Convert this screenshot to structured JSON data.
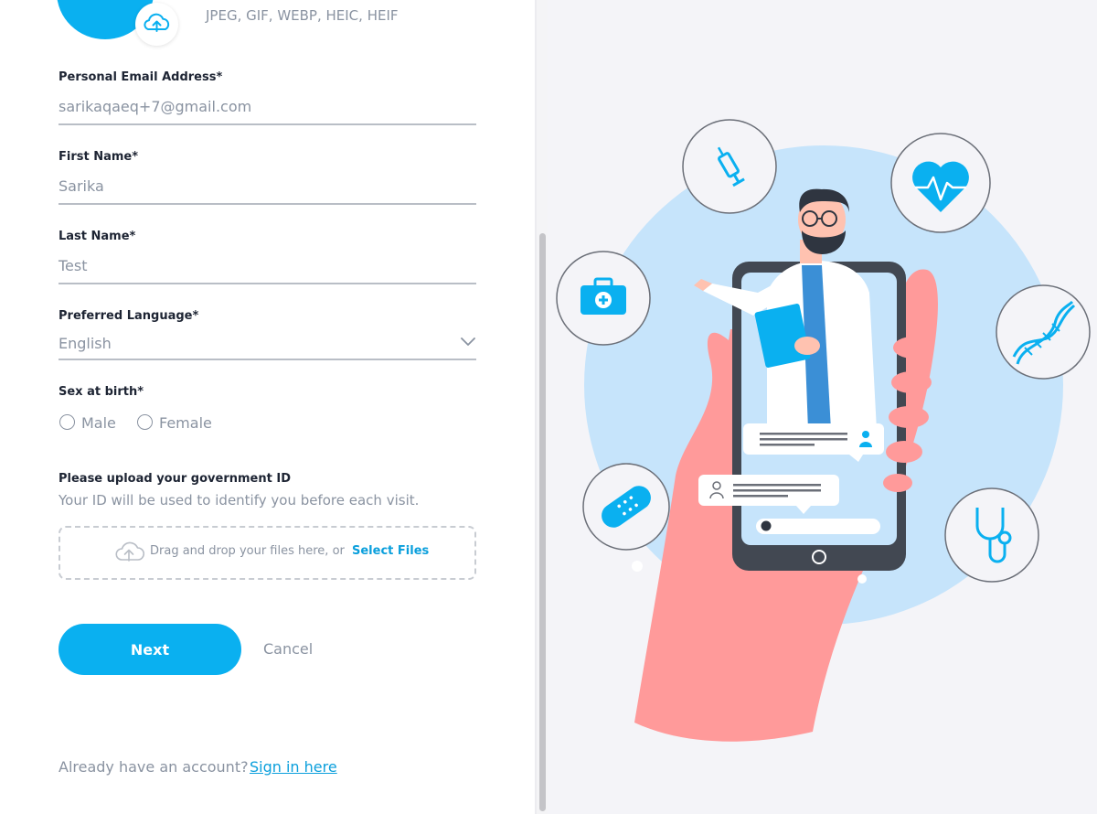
{
  "photo_upload": {
    "formats_text": "JPEG, GIF, WEBP, HEIC, HEIF",
    "upload_icon": "cloud-upload-icon"
  },
  "form": {
    "email": {
      "label": "Personal Email Address*",
      "value": "sarikaqaeq+7@gmail.com"
    },
    "first_name": {
      "label": "First Name*",
      "value": "Sarika"
    },
    "last_name": {
      "label": "Last Name*",
      "value": "Test"
    },
    "language": {
      "label": "Preferred Language*",
      "value": "English",
      "icon": "chevron-down-icon"
    },
    "sex": {
      "label": "Sex at birth*",
      "options": [
        "Male",
        "Female"
      ]
    },
    "government_id": {
      "label": "Please upload your government ID",
      "help": "Your ID will be used to identify you before each visit.",
      "dropzone_text": "Drag and drop your files here, or",
      "dropzone_link": "Select Files",
      "icon": "cloud-upload-icon"
    }
  },
  "actions": {
    "next": "Next",
    "cancel": "Cancel"
  },
  "footer": {
    "text": "Already have an account?",
    "link": "Sign in here"
  },
  "colors": {
    "accent": "#0ab0f0",
    "link": "#0a9fdc",
    "muted_text": "#8a93a1",
    "label_text": "#1d2433",
    "illustration_hand": "#ff9a9a",
    "illustration_circle": "#c6e4fb"
  }
}
